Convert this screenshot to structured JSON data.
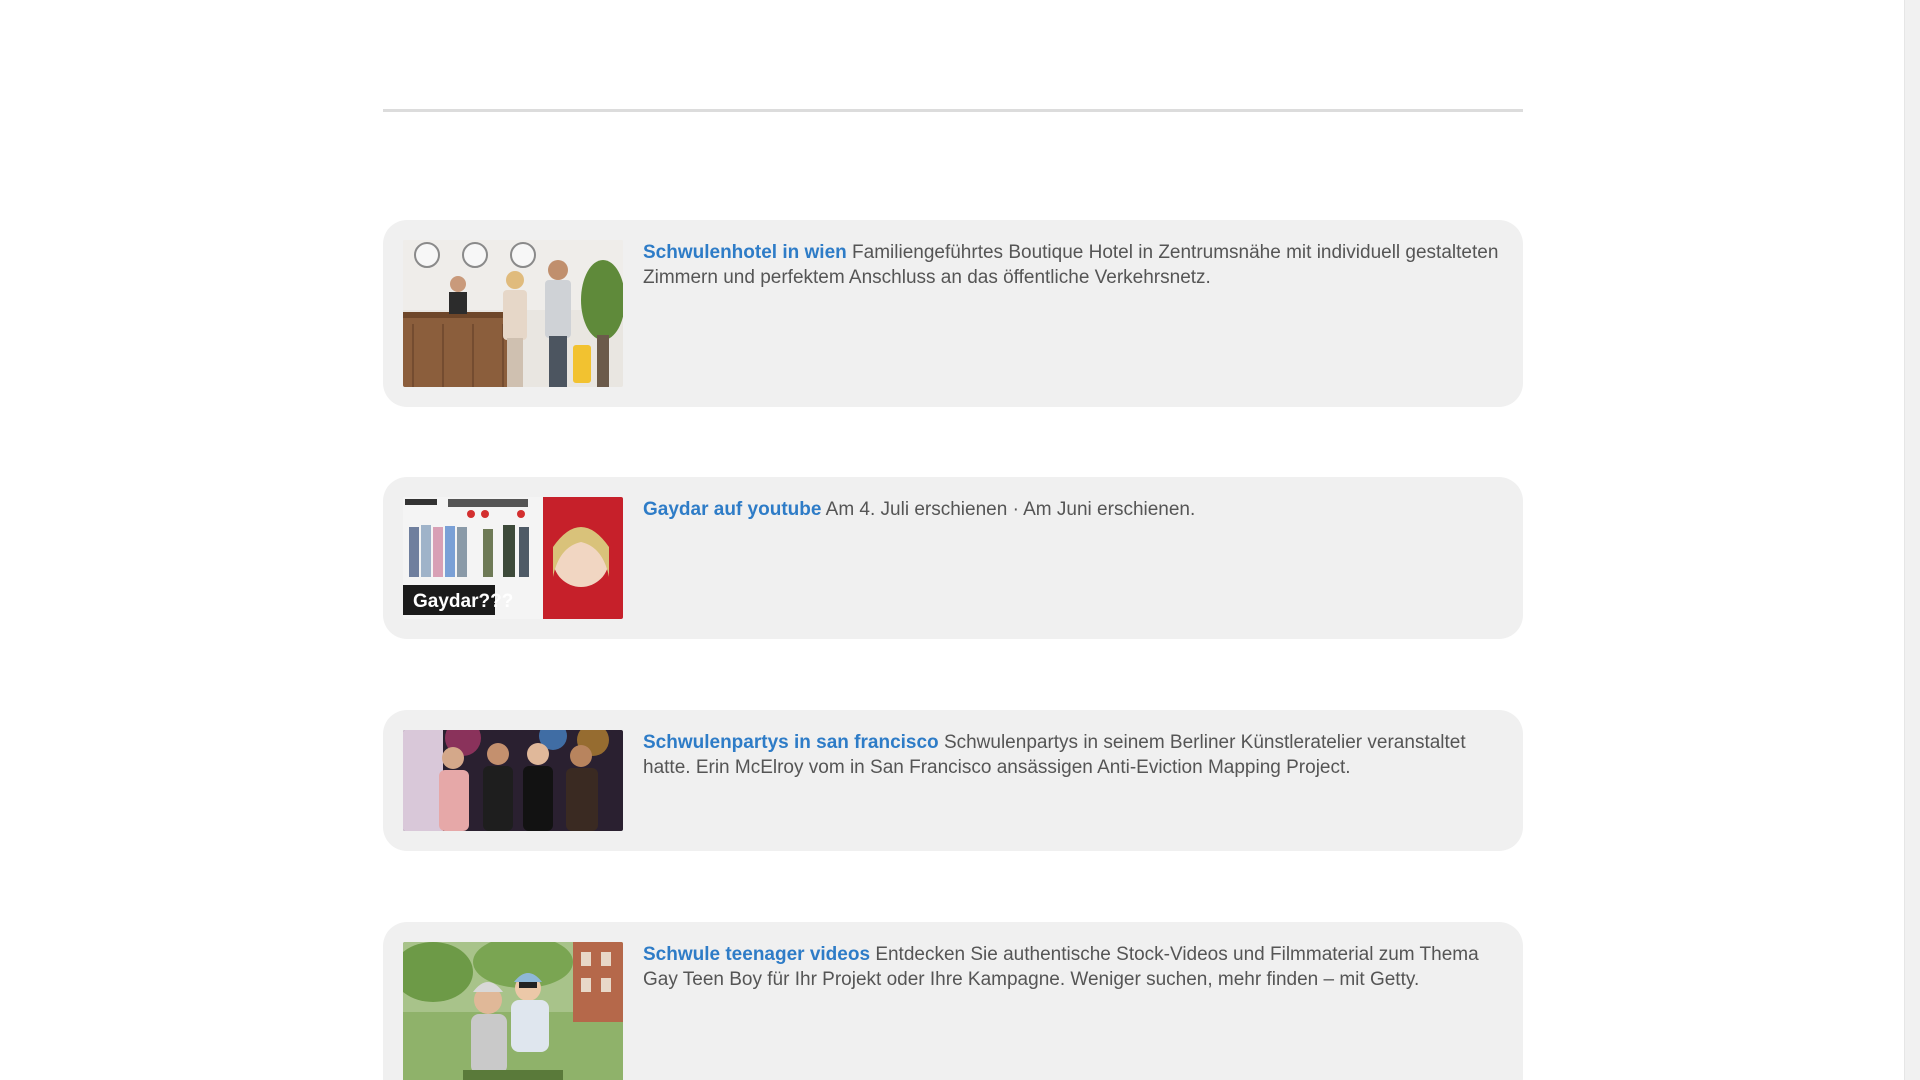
{
  "results": [
    {
      "title": "Schwulenhotel in wien",
      "snippet": "Familiengeführtes Boutique Hotel in Zentrumsnähe mit individuell gestalteten Zimmern und perfektem Anschluss an das öffentliche Verkehrsnetz."
    },
    {
      "title": "Gaydar auf youtube",
      "snippet": "Am 4. Juli erschienen · Am Juni erschienen.",
      "thumb_caption": "Gaydar???"
    },
    {
      "title": "Schwulenpartys in san francisco",
      "snippet": "Schwulenpartys in seinem Berliner Künstleratelier veranstaltet hatte. Erin McElroy vom in San Francisco ansässigen Anti-Eviction Mapping Project."
    },
    {
      "title": "Schwule teenager videos",
      "snippet": "Entdecken Sie authentische Stock-Videos und Filmmaterial zum Thema Gay Teen Boy für Ihr Projekt oder Ihre Kampagne. Weniger suchen, mehr finden – mit Getty."
    }
  ],
  "colors": {
    "link": "#2e7cc7",
    "text": "#555555",
    "card_bg": "#f0f0f0",
    "divider": "#dcdcdc"
  }
}
